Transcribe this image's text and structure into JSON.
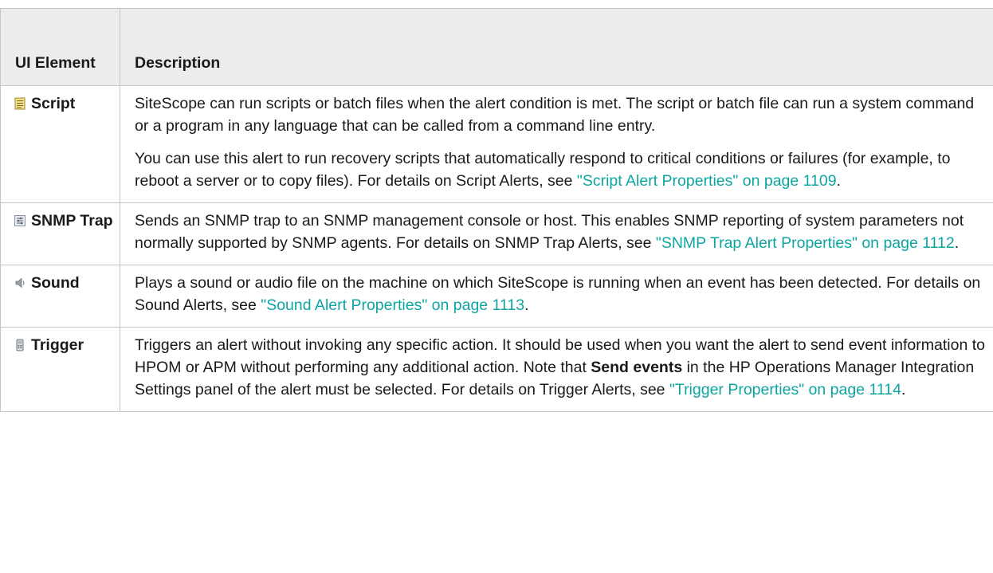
{
  "header": {
    "col1": "UI Element",
    "col2": "Description"
  },
  "rows": [
    {
      "element": "Script",
      "icon": "script-icon",
      "paragraphs": [
        {
          "pre": "SiteScope can run scripts or batch files when the alert condition is met. The script or batch file can run a system command or a program in any language that can be called from a command line entry.",
          "link": "",
          "post": ""
        },
        {
          "pre": "You can use this alert to run recovery scripts that automatically respond to critical conditions or failures (for example, to reboot a server or to copy files). For details on Script Alerts, see ",
          "link": "\"Script Alert Properties\" on page 1109",
          "post": "."
        }
      ]
    },
    {
      "element": "SNMP Trap",
      "icon": "snmp-trap-icon",
      "paragraphs": [
        {
          "pre": "Sends an SNMP trap to an SNMP management console or host. This enables SNMP reporting of system parameters not normally supported by SNMP agents. For details on SNMP Trap Alerts, see ",
          "link": "\"SNMP Trap Alert Properties\" on page 1112",
          "post": "."
        }
      ]
    },
    {
      "element": "Sound",
      "icon": "sound-icon",
      "paragraphs": [
        {
          "pre": "Plays a sound or audio file on the machine on which SiteScope is running when an event has been detected. For details on Sound Alerts, see ",
          "link": "\"Sound Alert Properties\" on page 1113",
          "post": "."
        }
      ]
    },
    {
      "element": "Trigger",
      "icon": "trigger-icon",
      "paragraphs": [
        {
          "pre": "Triggers an alert without invoking any specific action. It should be used when you want the alert to send event information to HPOM or APM without performing any additional action. Note that ",
          "bold": "Send events",
          "mid": " in the HP Operations Manager Integration Settings panel of the alert must be selected. For details on Trigger Alerts, see ",
          "link": "\"Trigger Properties\" on page 1114",
          "post": "."
        }
      ]
    }
  ],
  "colors": {
    "link": "#0da5a2",
    "header_bg": "#ececec",
    "border": "#c6c6c6"
  }
}
